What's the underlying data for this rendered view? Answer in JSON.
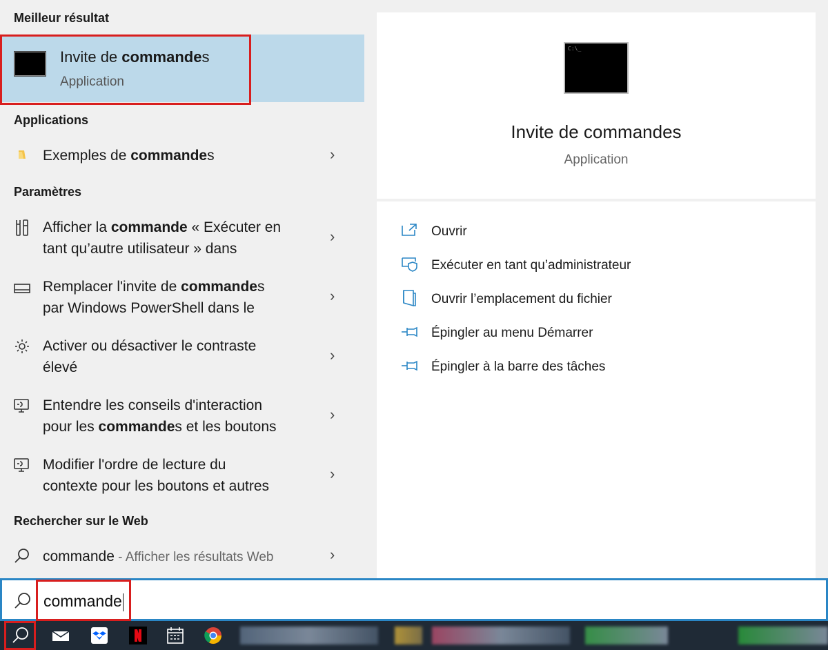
{
  "left": {
    "best_header": "Meilleur résultat",
    "best": {
      "title_pre": "Invite de ",
      "title_bold": "commande",
      "title_post": "s",
      "subtitle": "Application"
    },
    "apps_header": "Applications",
    "apps": [
      {
        "pre": "Exemples de ",
        "bold": "commande",
        "post": "s",
        "icon": "folder-icon"
      }
    ],
    "settings_header": "Paramètres",
    "settings": [
      {
        "l1_pre": "Afficher la ",
        "l1_bold": "commande",
        "l1_post": " « Exécuter en",
        "l2": "tant qu’autre utilisateur » dans",
        "icon": "tools-icon"
      },
      {
        "l1_pre": "Remplacer l'invite de ",
        "l1_bold": "commande",
        "l1_post": "s",
        "l2": "par Windows PowerShell dans le",
        "icon": "keyboard-icon"
      },
      {
        "l1_pre": "",
        "l1_bold": "",
        "l1_post": "Activer ou désactiver le contraste",
        "l2": "élevé",
        "icon": "brightness-icon"
      },
      {
        "l1_pre": "Entendre les conseils d'interaction",
        "l1_bold": "",
        "l1_post": "",
        "l2_pre": "pour les ",
        "l2_bold": "commande",
        "l2_post": "s et les boutons",
        "icon": "narrator-icon"
      },
      {
        "l1_pre": "Modifier l'ordre de lecture du",
        "l1_bold": "",
        "l1_post": "",
        "l2": "contexte pour les boutons et autres",
        "icon": "narrator-icon"
      }
    ],
    "web_header": "Rechercher sur le Web",
    "web": {
      "query": "commande",
      "hint": " - Afficher les résultats Web",
      "icon": "search-icon"
    }
  },
  "right": {
    "title": "Invite de commandes",
    "subtitle": "Application",
    "actions": [
      {
        "label": "Ouvrir",
        "icon": "open-icon"
      },
      {
        "label": "Exécuter en tant qu’administrateur",
        "icon": "shield-icon"
      },
      {
        "label": "Ouvrir l’emplacement du fichier",
        "icon": "file-location-icon"
      },
      {
        "label": "Épingler au menu Démarrer",
        "icon": "pin-icon"
      },
      {
        "label": "Épingler à la barre des tâches",
        "icon": "pin-icon"
      }
    ]
  },
  "search": {
    "value": "commande",
    "icon": "search-icon"
  },
  "colors": {
    "accent": "#2a86c5",
    "highlight": "#bcd9ea",
    "annotation_red": "#d81e1e",
    "taskbar": "#1f2a36"
  }
}
